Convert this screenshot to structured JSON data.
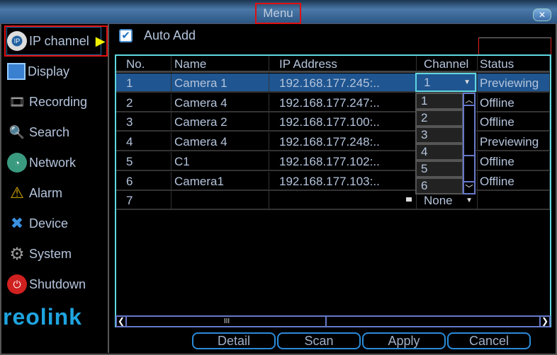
{
  "window": {
    "title": "Menu",
    "close_icon": "close-icon"
  },
  "sidebar": {
    "items": [
      {
        "label": "IP channel",
        "icon": "ip-camera-icon",
        "selected": true
      },
      {
        "label": "Display",
        "icon": "display-icon"
      },
      {
        "label": "Recording",
        "icon": "recording-icon"
      },
      {
        "label": "Search",
        "icon": "search-icon"
      },
      {
        "label": "Network",
        "icon": "network-icon"
      },
      {
        "label": "Alarm",
        "icon": "alarm-icon"
      },
      {
        "label": "Device",
        "icon": "device-icon"
      },
      {
        "label": "System",
        "icon": "system-icon"
      },
      {
        "label": "Shutdown",
        "icon": "shutdown-icon"
      }
    ],
    "logo": "reolink"
  },
  "auto_add": {
    "label": "Auto Add",
    "checked": true
  },
  "table": {
    "headers": [
      "No.",
      "Name",
      "IP Address",
      "Channel",
      "Status"
    ],
    "rows": [
      {
        "no": "1",
        "name": "Camera 1",
        "ip": "192.168.177.245:..",
        "channel": "1",
        "status": "Previewing"
      },
      {
        "no": "2",
        "name": "Camera 4",
        "ip": "192.168.177.247:..",
        "channel": "",
        "status": "Offline"
      },
      {
        "no": "3",
        "name": "Camera 2",
        "ip": "192.168.177.100:..",
        "channel": "",
        "status": "Offline"
      },
      {
        "no": "4",
        "name": "Camera 4",
        "ip": "192.168.177.248:..",
        "channel": "",
        "status": "Previewing"
      },
      {
        "no": "5",
        "name": "C1",
        "ip": "192.168.177.102:..",
        "channel": "",
        "status": "Offline"
      },
      {
        "no": "6",
        "name": "Camera1",
        "ip": "192.168.177.103:..",
        "channel": "",
        "status": "Offline"
      },
      {
        "no": "7",
        "name": "",
        "ip": "",
        "channel": "None",
        "status": ""
      }
    ],
    "channel_dropdown": {
      "selected": "1",
      "options": [
        "1",
        "2",
        "3",
        "4",
        "5",
        "6"
      ]
    },
    "hscroll_grip": "III"
  },
  "buttons": {
    "detail": "Detail",
    "scan": "Scan",
    "apply": "Apply",
    "cancel": "Cancel"
  },
  "colors": {
    "accent": "#1f5590",
    "border": "#5fd8e0",
    "highlight": "#e01010"
  }
}
